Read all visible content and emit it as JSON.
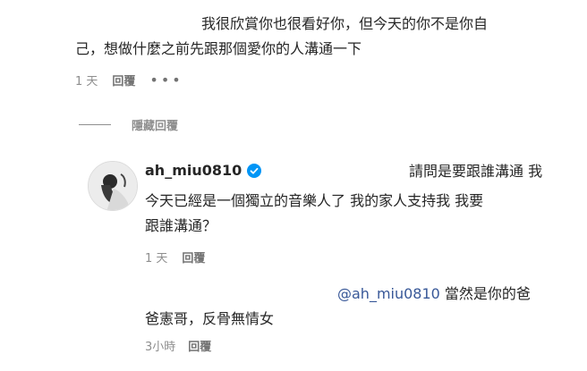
{
  "comment1": {
    "line1": "我很欣賞你也很看好你，但今天的你不是你自",
    "line2": "己，想做什麼之前先跟那個愛你的人溝通一下",
    "time": "1 天",
    "reply_label": "回覆",
    "more_label": "•••"
  },
  "hidden_replies_label": "隱藏回覆",
  "reply1": {
    "username": "ah_miu0810",
    "verified_icon": "verified-badge-icon",
    "line1": "請問是要跟誰溝通 我",
    "line2": "今天已經是一個獨立的音樂人了 我的家人支持我 我要",
    "line3": "跟誰溝通？",
    "time": "1 天",
    "reply_label": "回覆"
  },
  "reply2": {
    "mention": "@ah_miu0810",
    "line1_rest": " 當然是你的爸",
    "line2": "爸憲哥，反骨無情女",
    "time": "3小時",
    "reply_label": "回覆"
  },
  "colors": {
    "text": "#262626",
    "muted": "#8e8e8e",
    "mention": "#385898",
    "verified": "#0095f6"
  }
}
